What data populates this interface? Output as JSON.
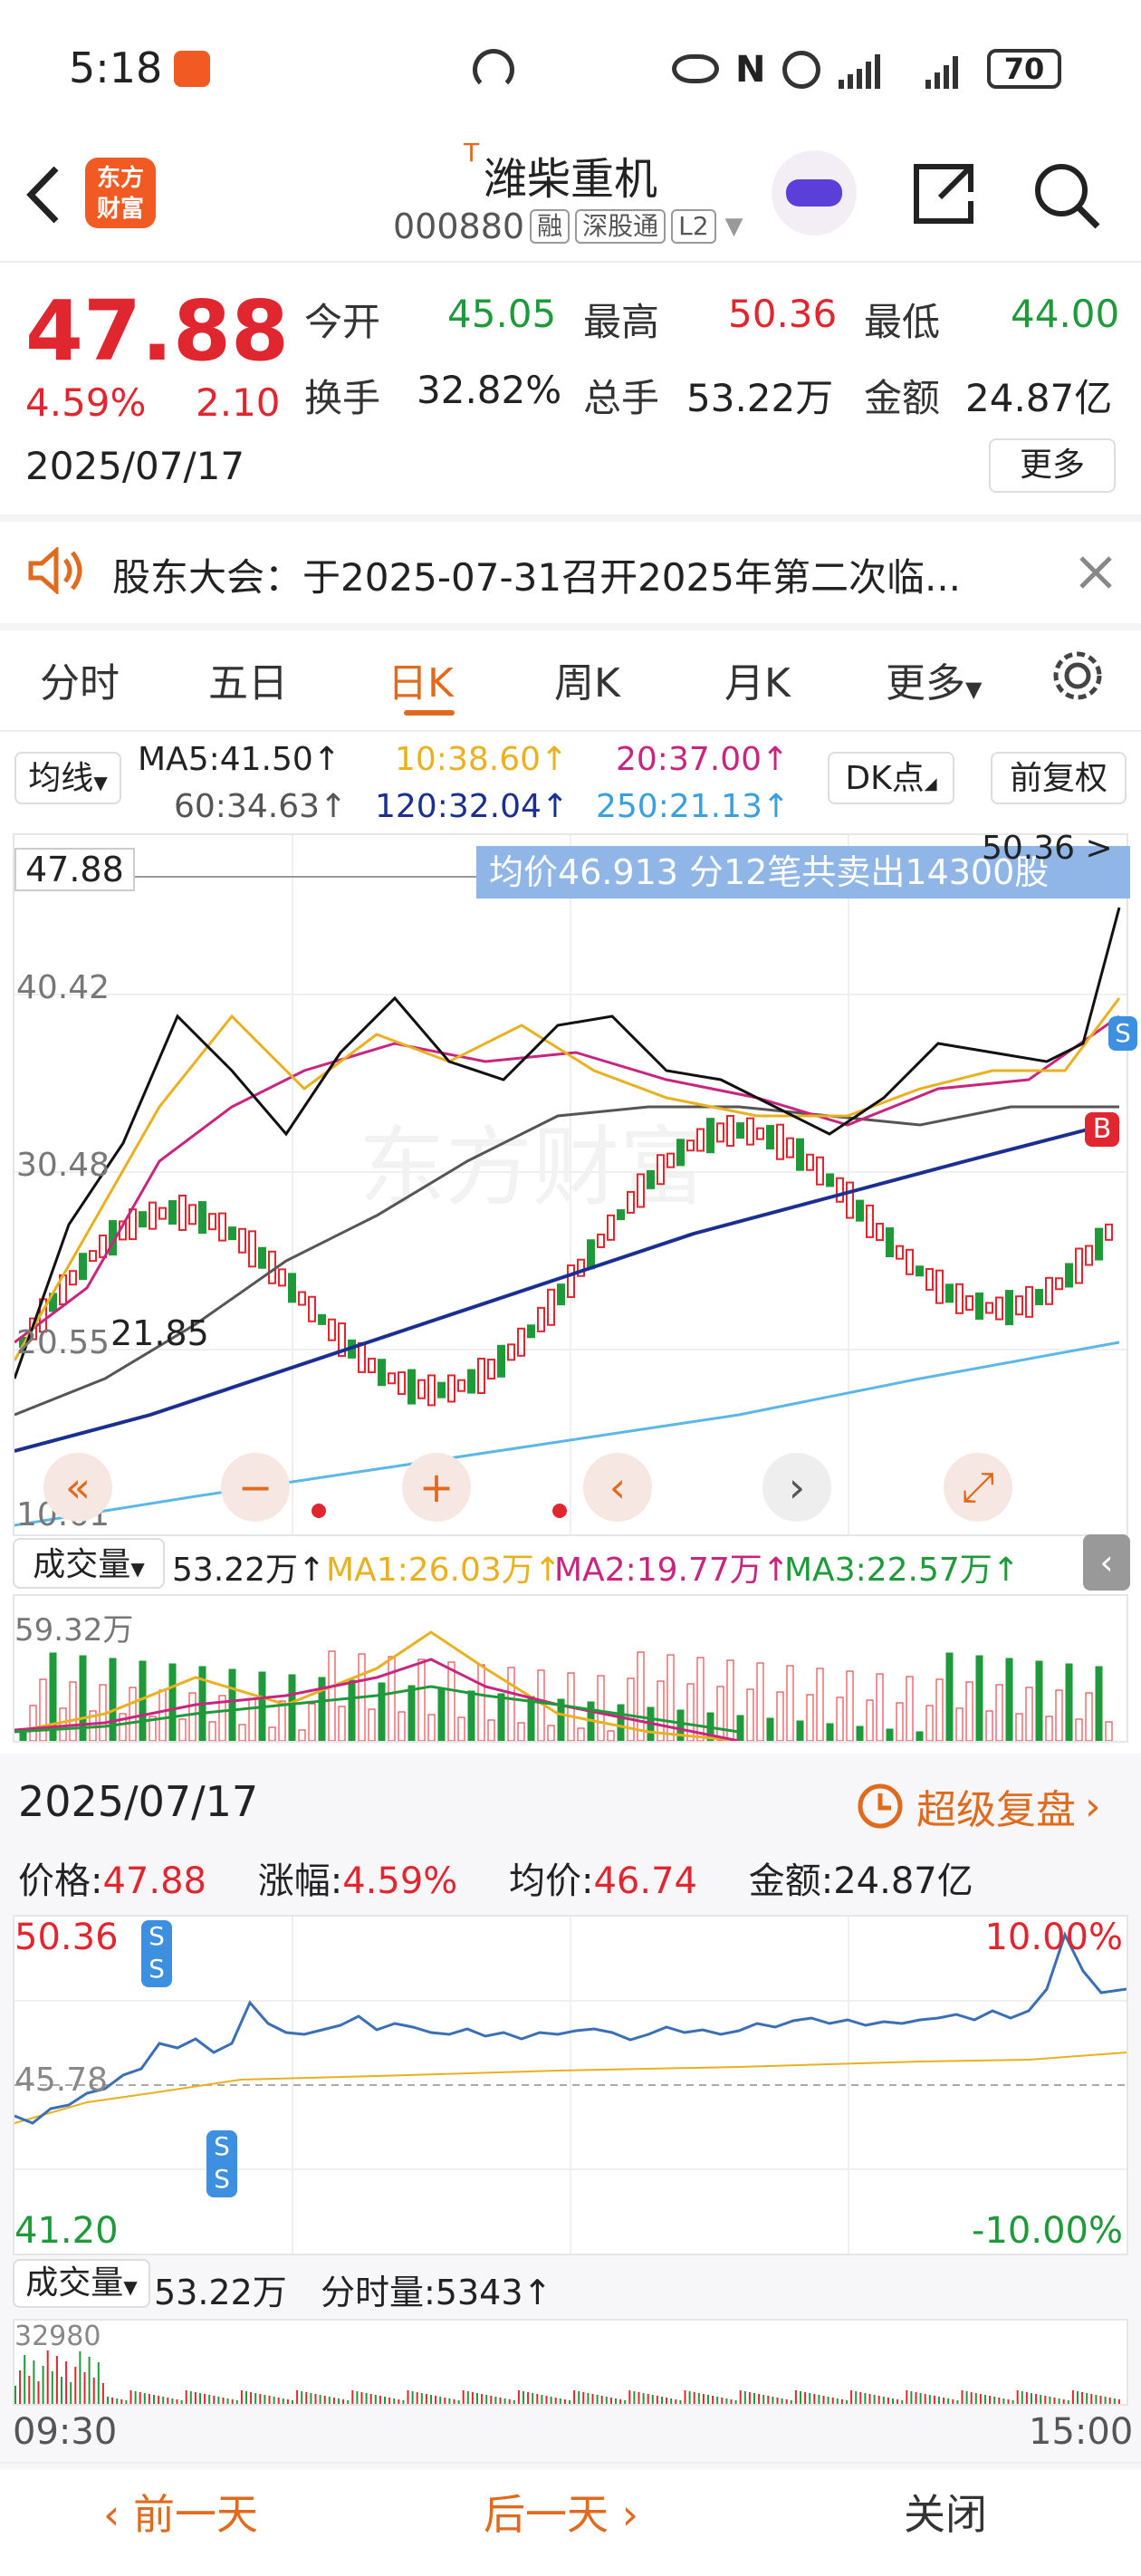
{
  "status_bar": {
    "time": "5:18",
    "battery": "70"
  },
  "header": {
    "stock_name": "潍柴重机",
    "prefix_mark": "T",
    "code": "000880",
    "badges": [
      "融",
      "深股通",
      "L2"
    ],
    "logo_text_line1": "东方",
    "logo_text_line2": "财富"
  },
  "quote": {
    "price": "47.88",
    "change_pct": "4.59%",
    "change": "2.10",
    "date": "2025/07/17",
    "open_label": "今开",
    "open": "45.05",
    "high_label": "最高",
    "high": "50.36",
    "low_label": "最低",
    "low": "44.00",
    "turnover_label": "换手",
    "turnover": "32.82%",
    "volume_label": "总手",
    "volume": "53.22万",
    "amount_label": "金额",
    "amount": "24.87亿",
    "more_button": "更多"
  },
  "notice": {
    "text": "股东大会：于2025-07-31召开2025年第二次临..."
  },
  "tabs": [
    "分时",
    "五日",
    "日K",
    "周K",
    "月K",
    "更多"
  ],
  "active_tab": "日K",
  "ma_bar": {
    "selector": "均线",
    "ma5": "MA5:41.50↑",
    "ma10": "10:38.60↑",
    "ma20": "20:37.00↑",
    "ma60": "60:34.63↑",
    "ma120": "120:32.04↑",
    "ma250": "250:21.13↑",
    "dk_button": "DK点",
    "fq_button": "前复权"
  },
  "kline": {
    "price_label": "47.88",
    "y_labels": [
      "40.42",
      "30.48",
      "20.55",
      "10.61"
    ],
    "top_label": "50.36",
    "low_marker": "21.85",
    "tooltip": "均价46.913  分12笔共卖出14300股",
    "watermark": "东方财富",
    "colors": {
      "ma5": "#111111",
      "ma10": "#e9b020",
      "ma20": "#c8267e",
      "ma60": "#555555",
      "ma120": "#1a2f8f",
      "ma250": "#5bb7e6",
      "up": "#e0262e",
      "down": "#1f9a3a"
    }
  },
  "volume_bar": {
    "selector": "成交量",
    "value": "53.22万↑",
    "ma1": "MA1:26.03万↑",
    "ma2": "MA2:19.77万↑",
    "ma3": "MA3:22.57万↑",
    "max_label": "59.32万"
  },
  "detail": {
    "date": "2025/07/17",
    "replay": "超级复盘",
    "price_label": "价格:",
    "price": "47.88",
    "chg_label": "涨幅:",
    "chg": "4.59%",
    "avg_label": "均价:",
    "avg": "46.74",
    "amount_label": "金额:",
    "amount": "24.87亿"
  },
  "intraday": {
    "high": "50.36",
    "mid": "45.78",
    "low": "41.20",
    "high_pct": "10.00%",
    "low_pct": "-10.00%",
    "vol_selector": "成交量",
    "vol_value": "53.22万",
    "minute_vol": "分时量:5343↑",
    "vol_max": "32980",
    "time_start": "09:30",
    "time_end": "15:00"
  },
  "bottom": {
    "prev": "前一天",
    "next": "后一天",
    "close": "关闭"
  }
}
